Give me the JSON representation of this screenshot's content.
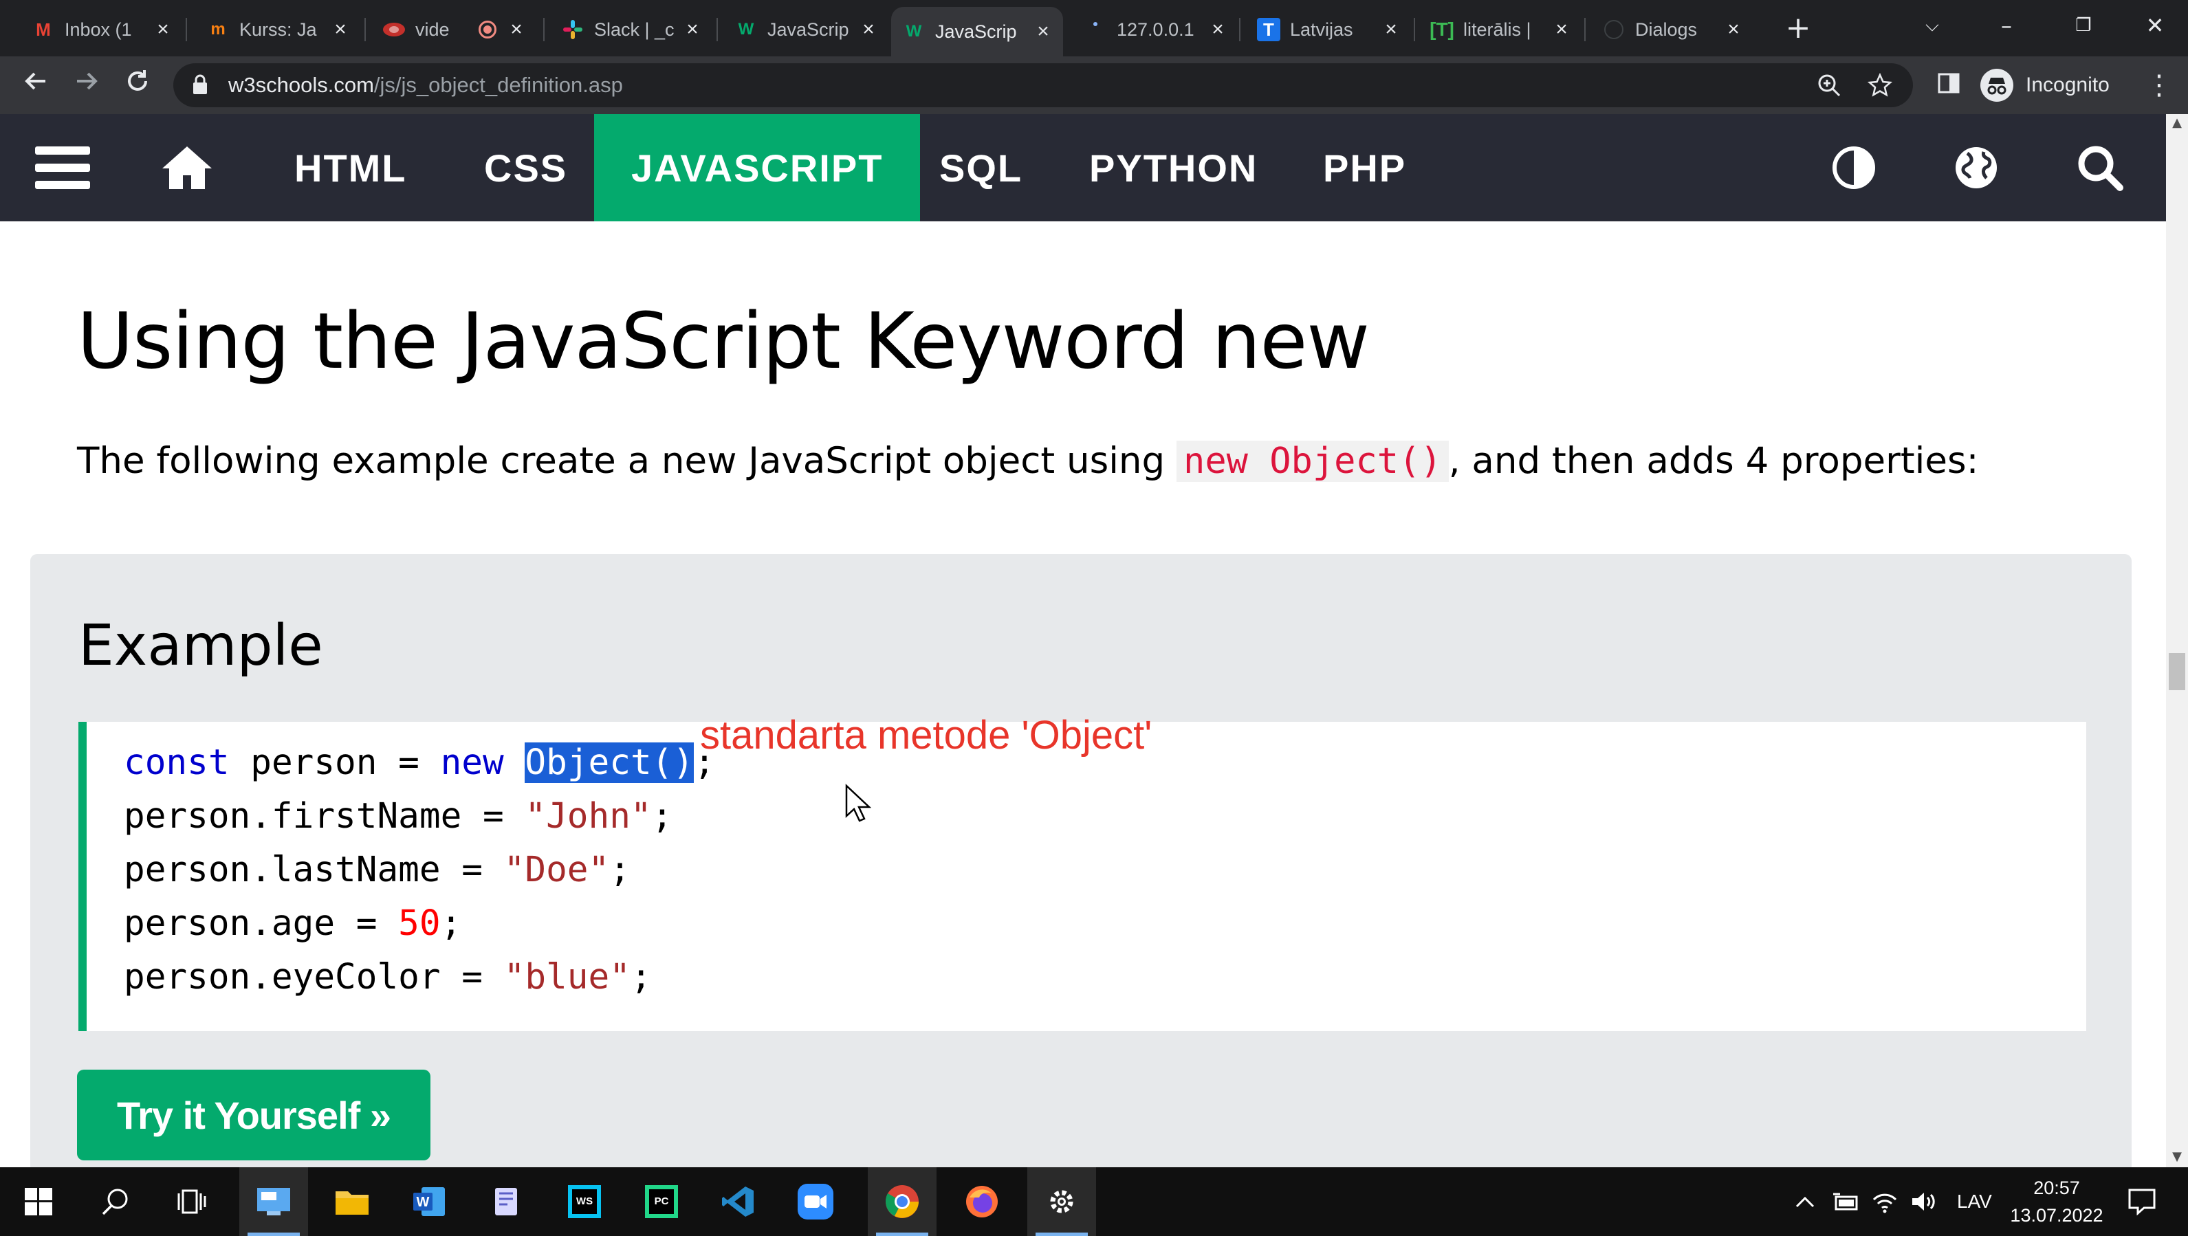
{
  "browser": {
    "tabs": [
      {
        "label": "Inbox (1",
        "icon": "gmail-icon"
      },
      {
        "label": "Kurss: Ja",
        "icon": "moodle-icon"
      },
      {
        "label": "vide",
        "icon": "video-icon"
      },
      {
        "label": "Slack | _c",
        "icon": "slack-icon"
      },
      {
        "label": "JavaScrip",
        "icon": "w3schools-icon"
      },
      {
        "label": "JavaScrip",
        "icon": "w3schools-icon"
      },
      {
        "label": "127.0.0.1",
        "icon": "loading-icon"
      },
      {
        "label": "Latvijas",
        "icon": "tezaurs-icon"
      },
      {
        "label": "literālis |",
        "icon": "tezaurs-bracket-icon"
      },
      {
        "label": "Dialogs",
        "icon": "globe-icon"
      }
    ],
    "active_tab_index": 5,
    "url_host": "w3schools.com",
    "url_path": "/js/js_object_definition.asp",
    "profile_label": "Incognito"
  },
  "nav": {
    "items": [
      "HTML",
      "CSS",
      "JAVASCRIPT",
      "SQL",
      "PYTHON",
      "PHP"
    ],
    "active": "JAVASCRIPT"
  },
  "content": {
    "title": "Using the JavaScript Keyword new",
    "intro_before": "The following example create a new JavaScript object using ",
    "intro_code": "new Object()",
    "intro_after": ", and then adds 4 properties:",
    "example_heading": "Example",
    "code": {
      "l1_kw1": "const",
      "l1_mid": " person = ",
      "l1_kw2": "new",
      "l1_sel": "Object()",
      "l1_end": ";",
      "l2_a": "person.firstName = ",
      "l2_str": "\"John\"",
      "l2_end": ";",
      "l3_a": "person.lastName = ",
      "l3_str": "\"Doe\"",
      "l3_end": ";",
      "l4_a": "person.age = ",
      "l4_num": "50",
      "l4_end": ";",
      "l5_a": "person.eyeColor = ",
      "l5_str": "\"blue\"",
      "l5_end": ";"
    },
    "annotation": "standarta metode 'Object'",
    "try_button": "Try it Yourself »"
  },
  "taskbar": {
    "language": "LAV",
    "time": "20:57",
    "date": "13.07.2022"
  },
  "colors": {
    "w3_green": "#04AA6D",
    "w3_nav": "#282A35",
    "annotation_red": "#e8352a",
    "selection_blue": "#1a5fd6"
  }
}
